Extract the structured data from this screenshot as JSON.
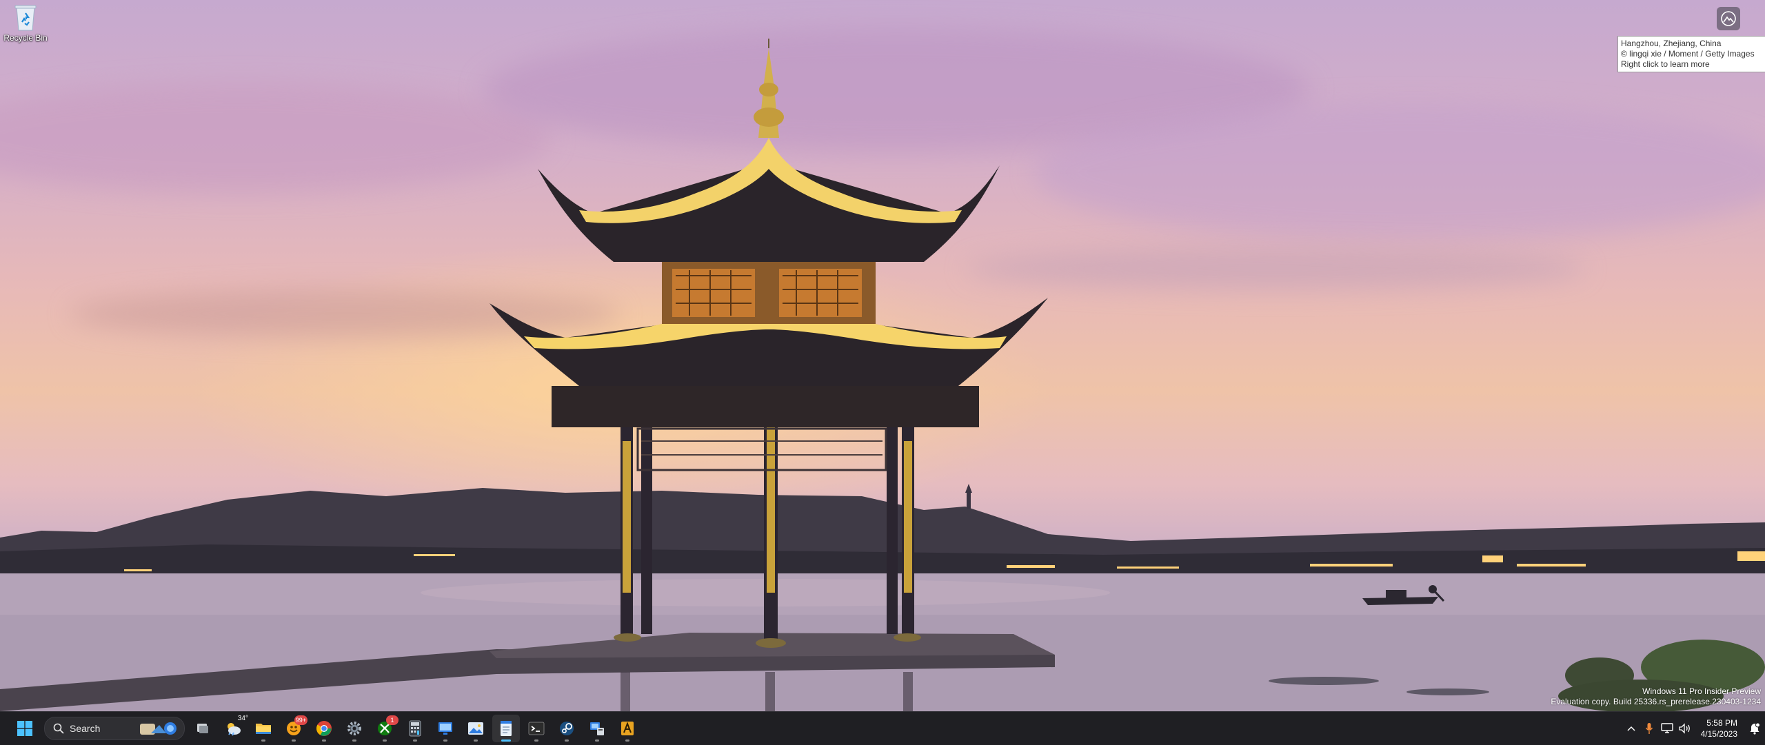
{
  "desktop": {
    "icons": [
      {
        "label": "Recycle Bin",
        "icon": "recycle-bin-icon"
      }
    ]
  },
  "spotlight": {
    "button_icon": "learn-more-icon",
    "location": "Hangzhou, Zhejiang, China",
    "credit": "© lingqi xie / Moment / Getty Images",
    "hint": "Right click to learn more"
  },
  "watermark": {
    "line1": "Windows 11 Pro Insider Preview",
    "line2": "Evaluation copy. Build 25336.rs_prerelease.230403-1234"
  },
  "taskbar": {
    "search_placeholder": "Search",
    "apps": [
      {
        "name": "task-view",
        "icon": "task-view-icon"
      },
      {
        "name": "weather",
        "icon": "weather-icon",
        "label": "34°"
      },
      {
        "name": "file-explorer",
        "icon": "folder-icon"
      },
      {
        "name": "chat",
        "icon": "chat-icon",
        "badge": "99+"
      },
      {
        "name": "chrome",
        "icon": "chrome-icon"
      },
      {
        "name": "settings",
        "icon": "gear-icon"
      },
      {
        "name": "xbox",
        "icon": "xbox-icon",
        "badge": "1"
      },
      {
        "name": "calculator",
        "icon": "calculator-icon"
      },
      {
        "name": "remote-desktop",
        "icon": "remote-desktop-icon"
      },
      {
        "name": "photos",
        "icon": "photos-icon"
      },
      {
        "name": "notepad",
        "icon": "notepad-icon",
        "active": true
      },
      {
        "name": "terminal",
        "icon": "terminal-icon"
      },
      {
        "name": "steam",
        "icon": "steam-icon"
      },
      {
        "name": "device-manager",
        "icon": "device-manager-icon"
      },
      {
        "name": "app",
        "icon": "app-icon"
      }
    ],
    "tray": {
      "time": "5:58 PM",
      "date": "4/15/2023"
    }
  },
  "colors": {
    "taskbar_bg": "#1f1f23",
    "accent": "#4cc2ff",
    "badge": "#e04848"
  }
}
